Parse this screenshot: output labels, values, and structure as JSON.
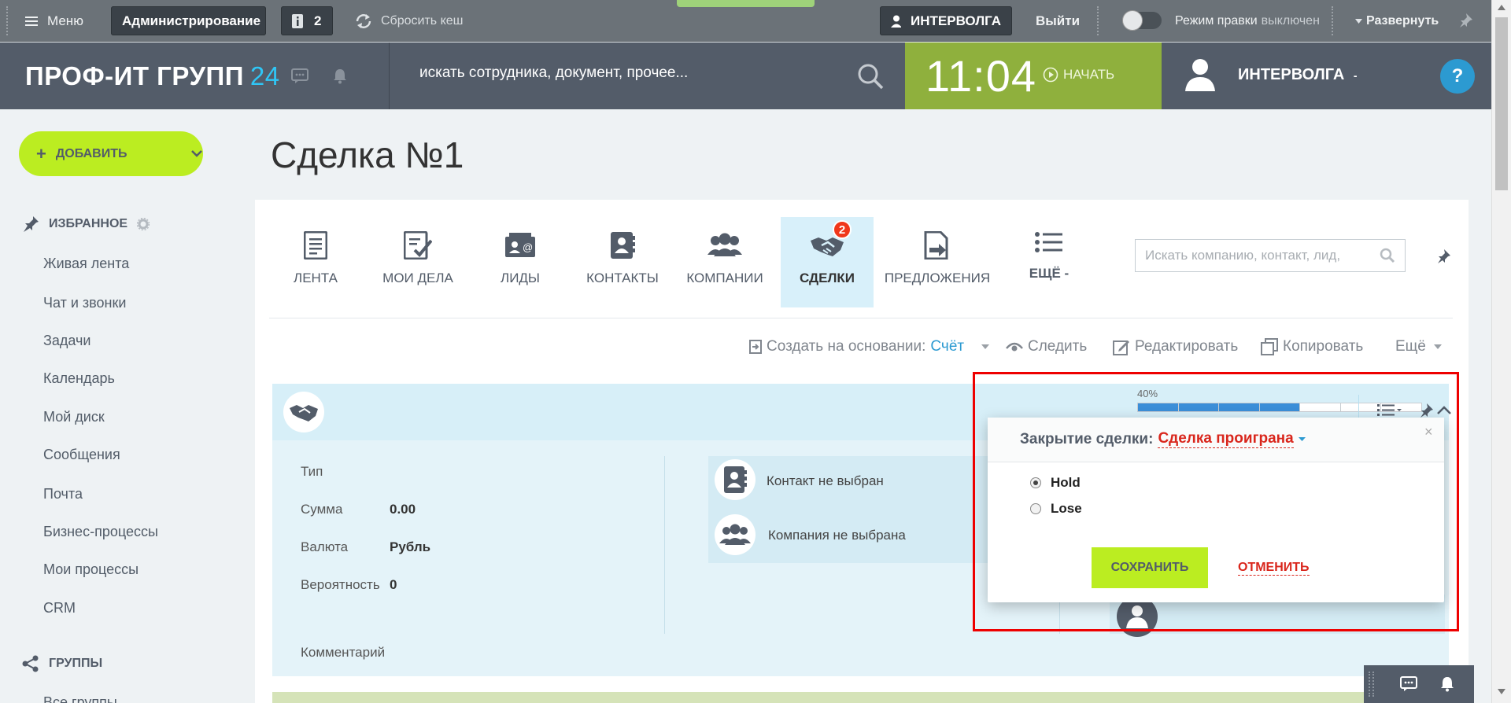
{
  "adminbar": {
    "menu_label": "Меню",
    "admin_label": "Администрирование",
    "notifications_count": "2",
    "reset_cache_label": "Сбросить кеш",
    "user_label": "ИНТЕРВОЛГА",
    "logout_label": "Выйти",
    "edit_mode_label": "Режим правки",
    "edit_mode_state": "выключен",
    "expand_label": "Развернуть"
  },
  "header": {
    "logo_text": "ПРОФ-ИТ ГРУПП",
    "logo_suffix": "24",
    "search_placeholder": "искать сотрудника, документ, прочее...",
    "clock": "11:04",
    "start_label": "НАЧАТЬ",
    "user_name": "ИНТЕРВОЛГА",
    "help_label": "?"
  },
  "sidebar": {
    "add_label": "ДОБАВИТЬ",
    "favorites_title": "ИЗБРАННОЕ",
    "items": [
      "Живая лента",
      "Чат и звонки",
      "Задачи",
      "Календарь",
      "Мой диск",
      "Сообщения",
      "Почта",
      "Бизнес-процессы",
      "Мои процессы",
      "CRM"
    ],
    "groups_title": "ГРУППЫ",
    "groups_first": "Все группы"
  },
  "page": {
    "title": "Сделка №1"
  },
  "crm": {
    "tabs": [
      {
        "label": "ЛЕНТА",
        "icon": "feed-icon"
      },
      {
        "label": "МОИ ДЕЛА",
        "icon": "tasks-icon"
      },
      {
        "label": "ЛИДЫ",
        "icon": "leads-icon"
      },
      {
        "label": "КОНТАКТЫ",
        "icon": "contacts-icon"
      },
      {
        "label": "КОМПАНИИ",
        "icon": "companies-icon"
      },
      {
        "label": "СДЕЛКИ",
        "icon": "handshake-icon",
        "badge": "2"
      },
      {
        "label": "ПРЕДЛОЖЕНИЯ",
        "icon": "quotes-icon"
      },
      {
        "label": "ЕЩЁ",
        "icon": "list-icon"
      }
    ],
    "search_placeholder": "Искать компанию, контакт, лид,",
    "actions": {
      "create_prefix": "Создать на основании:",
      "create_value": "Счёт",
      "follow": "Следить",
      "edit": "Редактировать",
      "copy": "Копировать",
      "more": "Ещё"
    }
  },
  "deal": {
    "progress_label": "40%",
    "progress_value": 0.4,
    "fields": [
      {
        "label": "Тип",
        "value": ""
      },
      {
        "label": "Сумма",
        "value": "0.00"
      },
      {
        "label": "Валюта",
        "value": "Рубль"
      },
      {
        "label": "Вероятность",
        "value": "0"
      }
    ],
    "comment_label": "Комментарий",
    "contact_empty": "Контакт не выбран",
    "company_empty": "Компания не выбрана"
  },
  "popup": {
    "title": "Закрытие сделки:",
    "status": "Сделка проиграна",
    "options": [
      {
        "label": "Hold",
        "checked": true
      },
      {
        "label": "Lose",
        "checked": false
      }
    ],
    "save_label": "СОХРАНИТЬ",
    "cancel_label": "ОТМЕНИТЬ",
    "close_label": "×"
  },
  "colors": {
    "accent_green": "#bbed21",
    "header_bg": "#535c69",
    "clock_bg": "#8fb03d",
    "link_blue": "#2c9ad1",
    "danger_red": "#d9261c",
    "highlight_frame": "#e00000"
  }
}
